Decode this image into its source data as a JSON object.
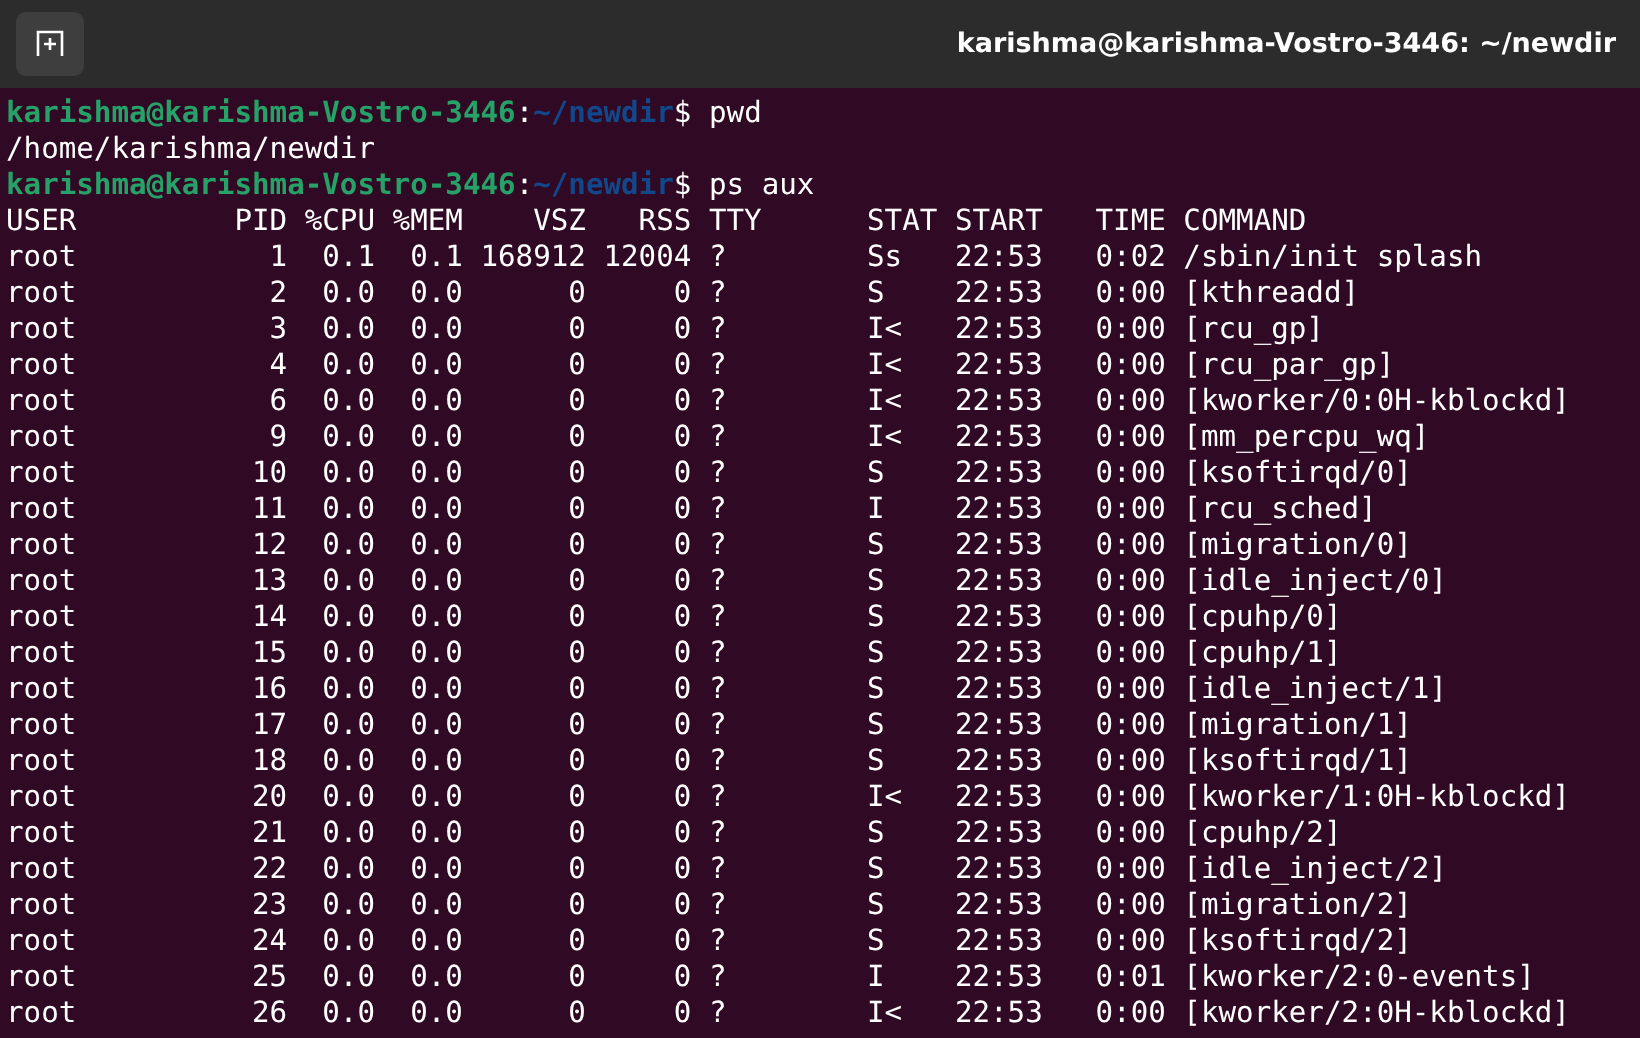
{
  "window": {
    "title": "karishma@karishma-Vostro-3446: ~/newdir"
  },
  "lines": [
    {
      "kind": "prompt",
      "user_host": "karishma@karishma-Vostro-3446",
      "separator": ":",
      "path": "~/newdir",
      "symbol": "$",
      "command": "pwd"
    },
    {
      "kind": "output",
      "text": "/home/karishma/newdir"
    },
    {
      "kind": "prompt",
      "user_host": "karishma@karishma-Vostro-3446",
      "separator": ":",
      "path": "~/newdir",
      "symbol": "$",
      "command": "ps aux"
    },
    {
      "kind": "output",
      "text": "USER         PID %CPU %MEM    VSZ   RSS TTY      STAT START   TIME COMMAND"
    },
    {
      "kind": "output",
      "text": "root           1  0.1  0.1 168912 12004 ?        Ss   22:53   0:02 /sbin/init splash"
    },
    {
      "kind": "output",
      "text": "root           2  0.0  0.0      0     0 ?        S    22:53   0:00 [kthreadd]"
    },
    {
      "kind": "output",
      "text": "root           3  0.0  0.0      0     0 ?        I<   22:53   0:00 [rcu_gp]"
    },
    {
      "kind": "output",
      "text": "root           4  0.0  0.0      0     0 ?        I<   22:53   0:00 [rcu_par_gp]"
    },
    {
      "kind": "output",
      "text": "root           6  0.0  0.0      0     0 ?        I<   22:53   0:00 [kworker/0:0H-kblockd]"
    },
    {
      "kind": "output",
      "text": "root           9  0.0  0.0      0     0 ?        I<   22:53   0:00 [mm_percpu_wq]"
    },
    {
      "kind": "output",
      "text": "root          10  0.0  0.0      0     0 ?        S    22:53   0:00 [ksoftirqd/0]"
    },
    {
      "kind": "output",
      "text": "root          11  0.0  0.0      0     0 ?        I    22:53   0:00 [rcu_sched]"
    },
    {
      "kind": "output",
      "text": "root          12  0.0  0.0      0     0 ?        S    22:53   0:00 [migration/0]"
    },
    {
      "kind": "output",
      "text": "root          13  0.0  0.0      0     0 ?        S    22:53   0:00 [idle_inject/0]"
    },
    {
      "kind": "output",
      "text": "root          14  0.0  0.0      0     0 ?        S    22:53   0:00 [cpuhp/0]"
    },
    {
      "kind": "output",
      "text": "root          15  0.0  0.0      0     0 ?        S    22:53   0:00 [cpuhp/1]"
    },
    {
      "kind": "output",
      "text": "root          16  0.0  0.0      0     0 ?        S    22:53   0:00 [idle_inject/1]"
    },
    {
      "kind": "output",
      "text": "root          17  0.0  0.0      0     0 ?        S    22:53   0:00 [migration/1]"
    },
    {
      "kind": "output",
      "text": "root          18  0.0  0.0      0     0 ?        S    22:53   0:00 [ksoftirqd/1]"
    },
    {
      "kind": "output",
      "text": "root          20  0.0  0.0      0     0 ?        I<   22:53   0:00 [kworker/1:0H-kblockd]"
    },
    {
      "kind": "output",
      "text": "root          21  0.0  0.0      0     0 ?        S    22:53   0:00 [cpuhp/2]"
    },
    {
      "kind": "output",
      "text": "root          22  0.0  0.0      0     0 ?        S    22:53   0:00 [idle_inject/2]"
    },
    {
      "kind": "output",
      "text": "root          23  0.0  0.0      0     0 ?        S    22:53   0:00 [migration/2]"
    },
    {
      "kind": "output",
      "text": "root          24  0.0  0.0      0     0 ?        S    22:53   0:00 [ksoftirqd/2]"
    },
    {
      "kind": "output",
      "text": "root          25  0.0  0.0      0     0 ?        I    22:53   0:01 [kworker/2:0-events]"
    },
    {
      "kind": "output",
      "text": "root          26  0.0  0.0      0     0 ?        I<   22:53   0:00 [kworker/2:0H-kblockd]"
    }
  ]
}
